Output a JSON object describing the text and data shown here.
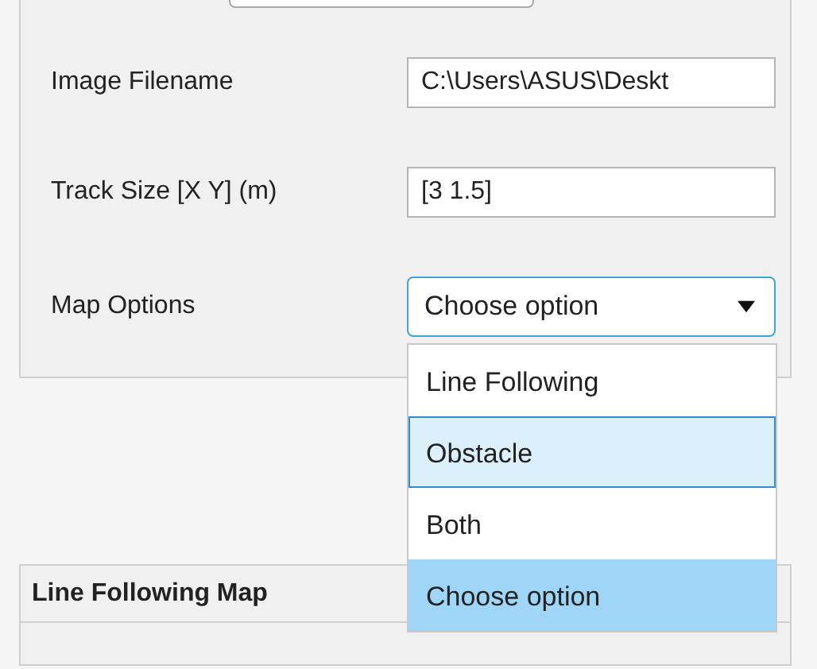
{
  "settings_panel": {
    "fields": [
      {
        "label": "Image Filename",
        "kind": "text",
        "value": "C:\\Users\\ASUS\\Deskt"
      },
      {
        "label": "Track Size [X Y] (m)",
        "kind": "text",
        "value": "[3 1.5]"
      },
      {
        "label": "Map Options",
        "kind": "dropdown",
        "value": "Choose option",
        "expanded": true
      }
    ]
  },
  "dropdown_options": [
    {
      "label": "Line Following",
      "selected": false,
      "hovered": false
    },
    {
      "label": "Obstacle",
      "selected": false,
      "hovered": true
    },
    {
      "label": "Both",
      "selected": false,
      "hovered": false
    },
    {
      "label": "Choose option",
      "selected": true,
      "hovered": false
    }
  ],
  "map_panel": {
    "title": "Line Following Map"
  }
}
